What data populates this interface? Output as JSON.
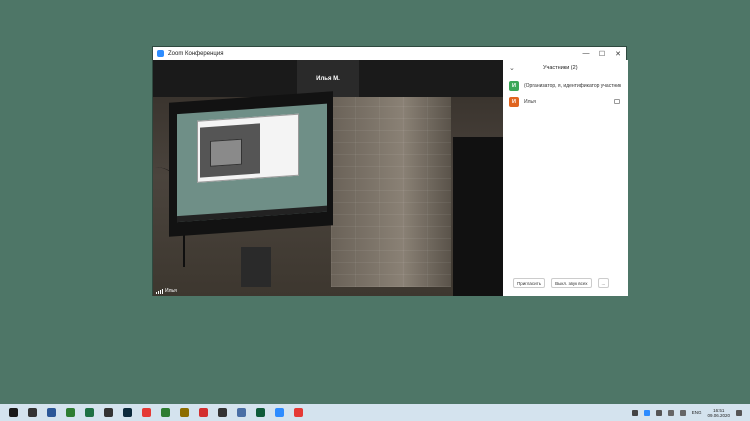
{
  "window": {
    "title": "Zoom Конференция",
    "controls": [
      "—",
      "☐",
      "✕"
    ]
  },
  "video": {
    "top_tile_name": "Илья М.",
    "camera_label": "Илья"
  },
  "participants_panel": {
    "title": "Участники (2)",
    "collapse_glyph": "⌄",
    "participants": [
      {
        "initial": "И",
        "name": "(Организатор, я, идентификатор участник",
        "color": "#3aa757"
      },
      {
        "initial": "И",
        "name": "Илья",
        "color": "#e0651f"
      }
    ],
    "buttons": {
      "invite": "Пригласить",
      "mute_all": "Выкл. звук всех",
      "more": "..."
    }
  },
  "taskbar": {
    "icons": [
      {
        "name": "start-icon",
        "color": "#1a1a1a"
      },
      {
        "name": "search-icon",
        "color": "#333333"
      },
      {
        "name": "floppy-icon",
        "color": "#2b5797"
      },
      {
        "name": "snake-icon",
        "color": "#2e7d32"
      },
      {
        "name": "excel-icon",
        "color": "#1e7145"
      },
      {
        "name": "mask-icon",
        "color": "#333333"
      },
      {
        "name": "photoshop-icon",
        "color": "#0c2a3c"
      },
      {
        "name": "chrome-icon",
        "color": "#e53935"
      },
      {
        "name": "bird-icon",
        "color": "#2e7d32"
      },
      {
        "name": "archive-icon",
        "color": "#8d6e00"
      },
      {
        "name": "opera-icon",
        "color": "#d32f2f"
      },
      {
        "name": "headphones-icon",
        "color": "#333333"
      },
      {
        "name": "maps-icon",
        "color": "#4a6fa5"
      },
      {
        "name": "terminal-icon",
        "color": "#0f5b3a"
      },
      {
        "name": "zoom-icon",
        "color": "#2d8cff"
      },
      {
        "name": "game-icon",
        "color": "#e53935"
      }
    ],
    "tray": {
      "language": "ENG",
      "time": "16:51",
      "date": "09.06.2020"
    }
  }
}
